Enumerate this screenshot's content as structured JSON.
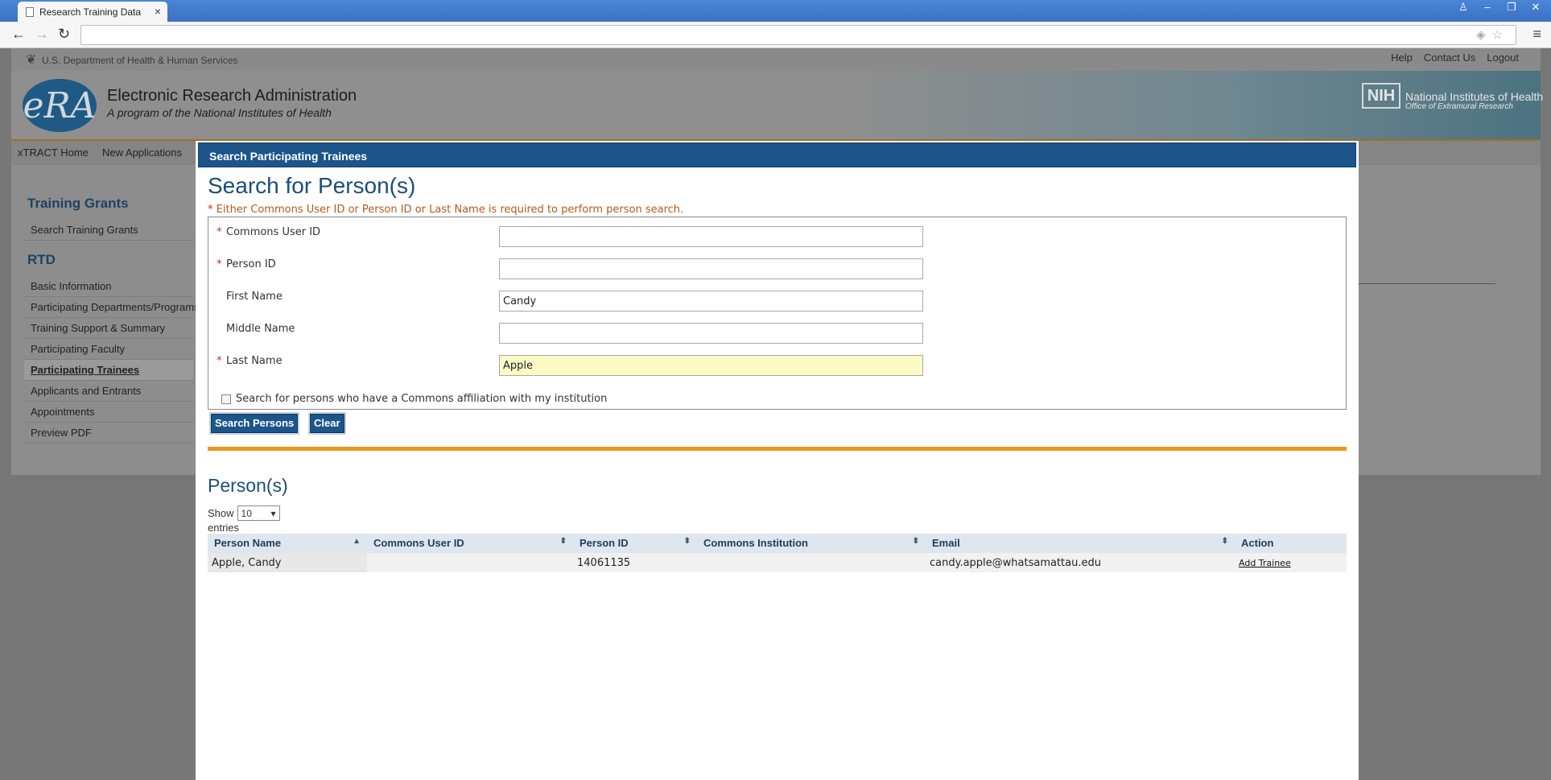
{
  "browser": {
    "tab_title": "Research Training Data",
    "tab_close": "×",
    "window_controls": [
      "♙",
      "–",
      "❐",
      "✕"
    ],
    "back_icon": "←",
    "forward_icon": "→",
    "reload_icon": "↻",
    "menu_icon": "≡"
  },
  "site": {
    "hhs_text": "U.S. Department of Health & Human Services",
    "util_links": [
      "Help",
      "Contact Us",
      "Logout"
    ],
    "logo_text": "eRA",
    "title": "Electronic Research Administration",
    "subtitle": "A program of the National Institutes of Health",
    "nih_logo": "NIH",
    "nih_title": "National Institutes of Health",
    "nih_sub": "Office of Extramural Research",
    "nav": [
      "xTRACT Home",
      "New Applications"
    ]
  },
  "sidebar": {
    "heading_training": "Training Grants",
    "training_items": [
      "Search Training Grants"
    ],
    "heading_rtd": "RTD",
    "rtd_items": [
      "Basic Information",
      "Participating Departments/Programs",
      "Training Support & Summary",
      "Participating Faculty",
      "Participating Trainees",
      "Applicants and Entrants",
      "Appointments",
      "Preview PDF"
    ]
  },
  "modal": {
    "header": "Search Participating Trainees",
    "title": "Search for Person(s)",
    "req_star": "*",
    "required_note": "Either Commons User ID or Person ID or Last Name is required to perform person search.",
    "fields": {
      "commons_user_id": {
        "label": "Commons User ID",
        "value": ""
      },
      "person_id": {
        "label": "Person ID",
        "value": ""
      },
      "first_name": {
        "label": "First Name",
        "value": "Candy"
      },
      "middle_name": {
        "label": "Middle Name",
        "value": ""
      },
      "last_name": {
        "label": "Last Name",
        "value": "Apple"
      }
    },
    "affiliation_checkbox": "Search for persons who have a Commons affiliation with my institution",
    "search_button": "Search Persons",
    "clear_button": "Clear"
  },
  "results": {
    "title": "Person(s)",
    "show_label": "Show",
    "page_size": "10",
    "entries_label": "entries",
    "sort_asc": "▲",
    "sort_both": "⬍",
    "columns": [
      "Person Name",
      "Commons User ID",
      "Person ID",
      "Commons Institution",
      "Email",
      "Action"
    ],
    "rows": [
      {
        "person_name": "Apple, Candy",
        "commons_user_id": "",
        "person_id": "14061135",
        "commons_institution": "",
        "email": "candy.apple@whatsamattau.edu",
        "action": "Add Trainee"
      }
    ]
  },
  "colors": {
    "brand_blue": "#1b558a",
    "accent_orange": "#e8961e",
    "highlight_yellow": "#fbfbc6",
    "required_red": "#c8292b"
  }
}
